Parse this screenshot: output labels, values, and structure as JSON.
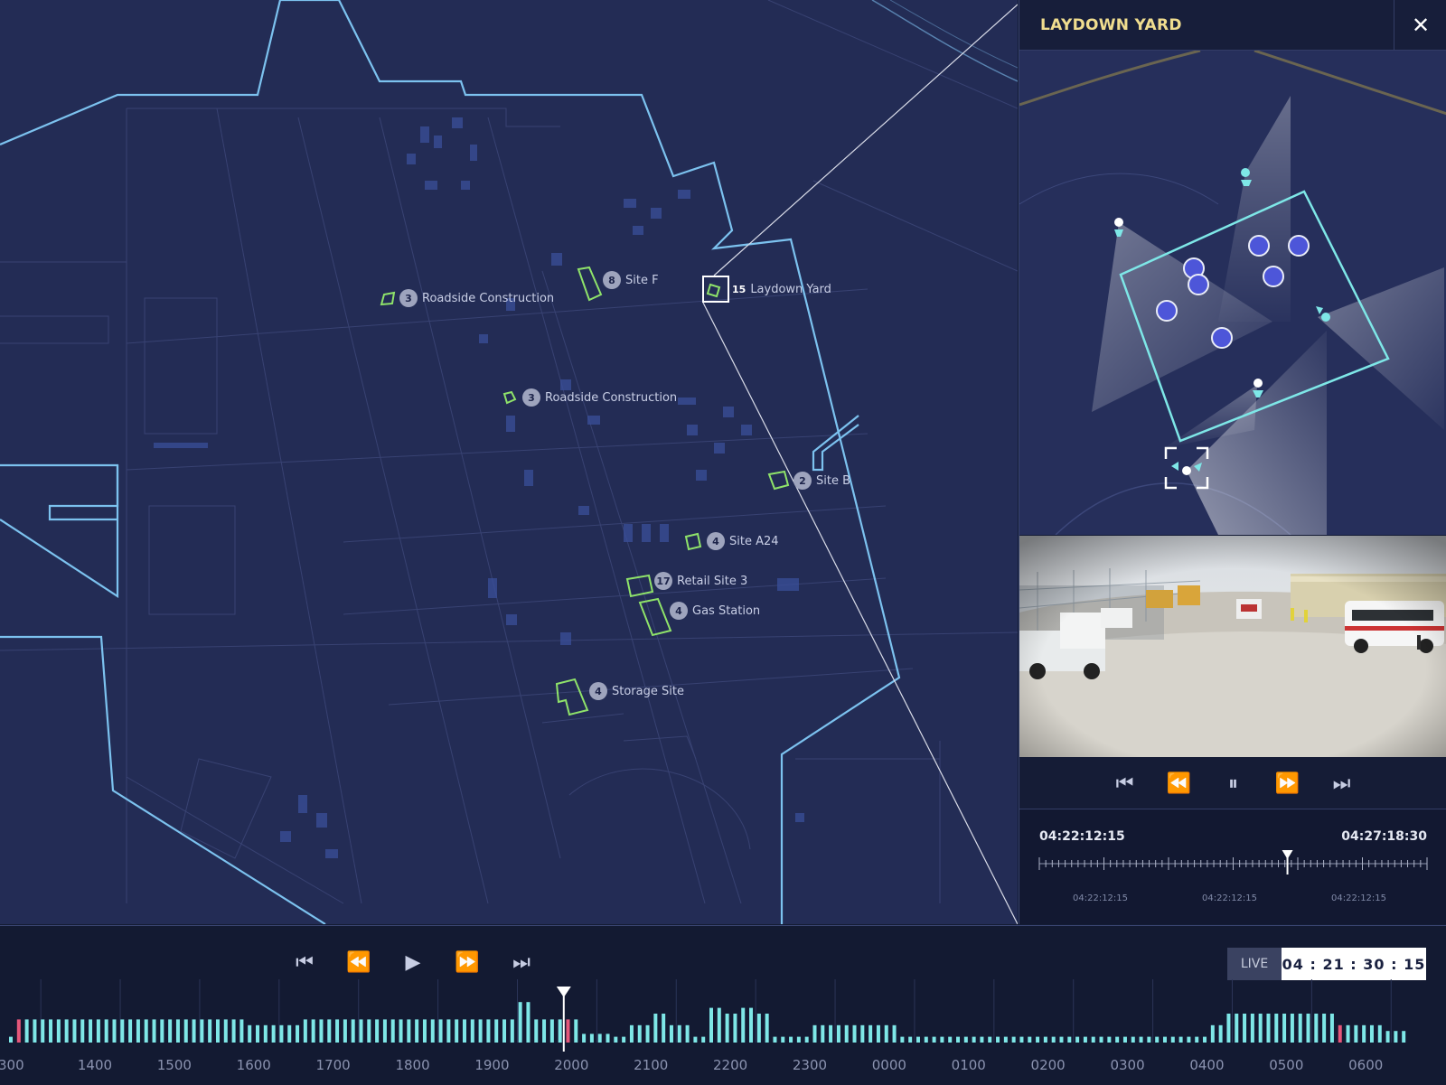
{
  "panel": {
    "title": "LAYDOWN YARD",
    "close_icon": "close-icon",
    "playback_icons": [
      "skip-to-start-icon",
      "rewind-icon",
      "pause-icon",
      "fast-forward-icon",
      "skip-to-end-icon"
    ],
    "timeline": {
      "start": "04:22:12:15",
      "end": "04:27:18:30",
      "tick_labels": [
        "04:22:12:15",
        "04:22:12:15",
        "04:22:12:15"
      ],
      "playhead_position": 0.64
    }
  },
  "map": {
    "sites": [
      {
        "count": "3",
        "name": "Roadside Construction"
      },
      {
        "count": "8",
        "name": "Site F"
      },
      {
        "count": "15",
        "name": "Laydown Yard",
        "selected": true
      },
      {
        "count": "3",
        "name": "Roadside Construction"
      },
      {
        "count": "2",
        "name": "Site B"
      },
      {
        "count": "4",
        "name": "Site A24"
      },
      {
        "count": "17",
        "name": "Retail Site 3"
      },
      {
        "count": "4",
        "name": "Gas Station"
      },
      {
        "count": "4",
        "name": "Storage Site"
      }
    ]
  },
  "bottom": {
    "playback_icons": [
      "skip-to-start-icon",
      "rewind-icon",
      "play-icon",
      "fast-forward-icon",
      "skip-to-end-icon"
    ],
    "live_label": "LIVE",
    "live_time": "04 : 21 : 30 : 15",
    "hour_labels": [
      "300",
      "1400",
      "1500",
      "1600",
      "1700",
      "1800",
      "1900",
      "2000",
      "2100",
      "2200",
      "2300",
      "0000",
      "0100",
      "0200",
      "0300",
      "0400",
      "0500",
      "0600"
    ],
    "playhead_position": 0.396
  },
  "colors": {
    "accent": "#7ee7e7",
    "alert": "#e5577a",
    "site_outline": "#8fe36a",
    "boundary": "#7cc2ef",
    "title": "#f0dd8f"
  },
  "activity": [
    2,
    8,
    8,
    8,
    8,
    8,
    8,
    8,
    8,
    8,
    8,
    8,
    8,
    8,
    8,
    8,
    8,
    8,
    8,
    8,
    8,
    8,
    8,
    8,
    8,
    8,
    8,
    8,
    8,
    8,
    6,
    6,
    6,
    6,
    6,
    6,
    6,
    8,
    8,
    8,
    8,
    8,
    8,
    8,
    8,
    8,
    8,
    8,
    8,
    8,
    8,
    8,
    8,
    8,
    8,
    8,
    8,
    8,
    8,
    8,
    8,
    8,
    8,
    8,
    14,
    14,
    8,
    8,
    8,
    8,
    8,
    8,
    3,
    3,
    3,
    3,
    2,
    2,
    6,
    6,
    6,
    10,
    10,
    6,
    6,
    6,
    2,
    2,
    12,
    12,
    10,
    10,
    12,
    12,
    10,
    10,
    2,
    2,
    2,
    2,
    2,
    6,
    6,
    6,
    6,
    6,
    6,
    6,
    6,
    6,
    6,
    6,
    2,
    2,
    2,
    2,
    2,
    2,
    2,
    2,
    2,
    2,
    2,
    2,
    2,
    2,
    2,
    2,
    2,
    2,
    2,
    2,
    2,
    2,
    2,
    2,
    2,
    2,
    2,
    2,
    2,
    2,
    2,
    2,
    2,
    2,
    2,
    2,
    2,
    2,
    2,
    6,
    6,
    10,
    10,
    10,
    10,
    10,
    10,
    10,
    10,
    10,
    10,
    10,
    10,
    10,
    10,
    6,
    6,
    6,
    6,
    6,
    6,
    4,
    4,
    4
  ],
  "activity_alert_indices": [
    1,
    70,
    167
  ]
}
